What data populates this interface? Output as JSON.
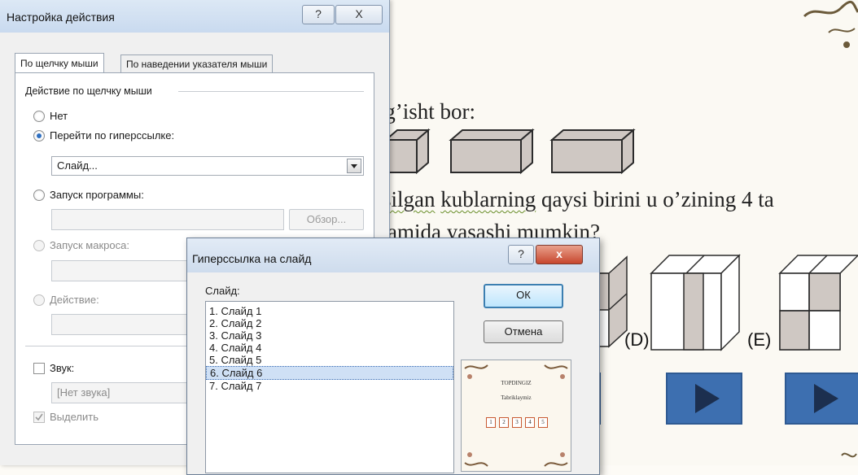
{
  "slide": {
    "line1": "n g’isht bor:",
    "line2_a": "silgan",
    "line2_b": "kublarning",
    "line2_c": " qaysi birini u o’zining 4 ta",
    "line3": "amida yasashi mumkin?",
    "label_d": "(D)",
    "label_e": "(E)"
  },
  "action_dialog": {
    "title": "Настройка действия",
    "help_icon": "?",
    "close_icon": "X",
    "tabs": [
      "По щелчку мыши",
      "По наведении указателя мыши"
    ],
    "group_label": "Действие по щелчку мыши",
    "options": {
      "none": "Нет",
      "hyperlink": "Перейти по гиперссылке:",
      "run_program": "Запуск программы:",
      "run_macro": "Запуск макроса:",
      "action": "Действие:"
    },
    "hyperlink_value": "Слайд...",
    "browse_button": "Обзор...",
    "sound_label": "Звук:",
    "sound_value": "[Нет звука]",
    "highlight_label": "Выделить"
  },
  "hyperlink_dialog": {
    "title": "Гиперссылка на слайд",
    "help_icon": "?",
    "close_icon": "x",
    "list_label": "Слайд:",
    "slides": [
      "1. Слайд 1",
      "2. Слайд 2",
      "3. Слайд 3",
      "4. Слайд 4",
      "5. Слайд 5",
      "6. Слайд 6",
      "7. Слайд 7"
    ],
    "selected_index": 5,
    "ok_button": "ОК",
    "cancel_button": "Отмена",
    "preview": {
      "heading": "TOPDINGIZ",
      "subheading": "Tabriklaymiz",
      "boxes": [
        "1",
        "2",
        "3",
        "4",
        "5"
      ]
    }
  },
  "colors": {
    "accent": "#3d6fb0",
    "selection": "#cfe0f5",
    "close_red": "#c7472e"
  }
}
